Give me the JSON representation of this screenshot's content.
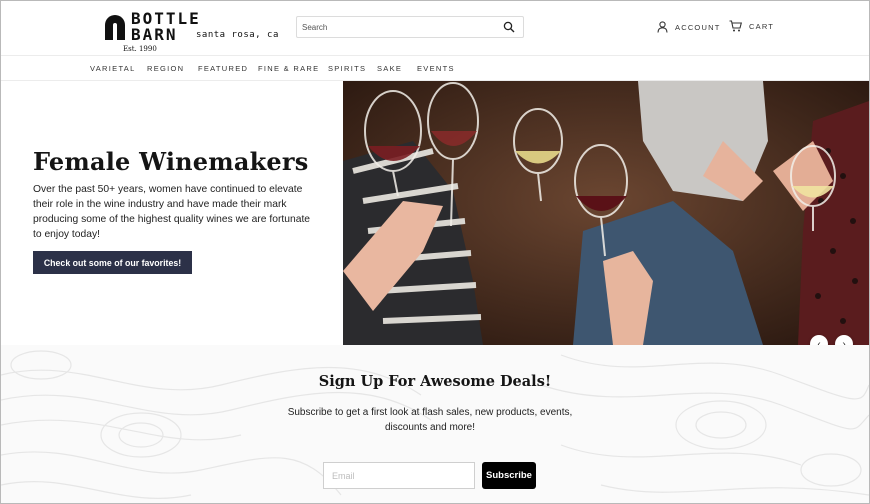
{
  "brand": {
    "line1": "BOTTLE",
    "line2": "BARN",
    "location": "santa rosa, ca",
    "established": "Est. 1990"
  },
  "search": {
    "placeholder": "Search",
    "icon": "search-icon"
  },
  "header_links": {
    "account": "ACCOUNT",
    "cart": "CART"
  },
  "nav": {
    "items": [
      "VARIETAL",
      "REGION",
      "FEATURED",
      "FINE & RARE",
      "SPIRITS",
      "SAKE",
      "EVENTS"
    ]
  },
  "hero": {
    "title": "Female Winemakers",
    "body": "Over the past 50+ years, women have continued to elevate their role in the wine industry and have made their mark producing some of the highest quality wines we are fortunate to enjoy today!",
    "button": "Check out some of our favorites!",
    "image_icon": "wine-glasses-toast-photo"
  },
  "carousel": {
    "prev": "‹",
    "next": "›"
  },
  "signup": {
    "title": "Sign Up For Awesome Deals!",
    "body": "Subscribe to get a first look at flash sales, new products, events, discounts and more!",
    "email_placeholder": "Email",
    "button": "Subscribe"
  },
  "colors": {
    "button_bg": "#2c3148",
    "subscribe_bg": "#000000"
  }
}
